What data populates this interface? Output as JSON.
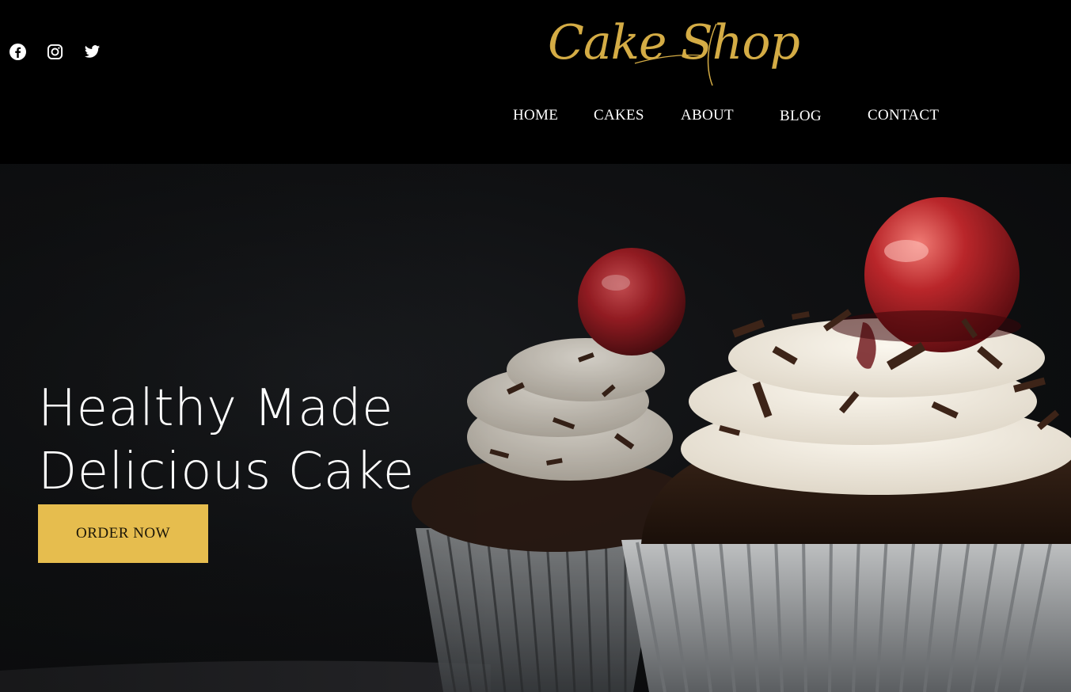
{
  "header": {
    "logo_text": "Cake Shop",
    "social": [
      {
        "icon": "facebook-icon"
      },
      {
        "icon": "instagram-icon"
      },
      {
        "icon": "twitter-icon"
      }
    ],
    "nav": [
      {
        "label": "HOME"
      },
      {
        "label": "CAKES"
      },
      {
        "label": "ABOUT"
      },
      {
        "label": "BLOG"
      },
      {
        "label": "CONTACT"
      }
    ]
  },
  "hero": {
    "title_line1": "Healthy Made",
    "title_line2": "Delicious Cake",
    "cta_label": "ORDER NOW",
    "image": "chocolate-cupcakes-with-cherries-image"
  },
  "colors": {
    "accent": "#e6bd4e",
    "logo": "#d4ac45",
    "background": "#000000",
    "text": "#ffffff"
  }
}
